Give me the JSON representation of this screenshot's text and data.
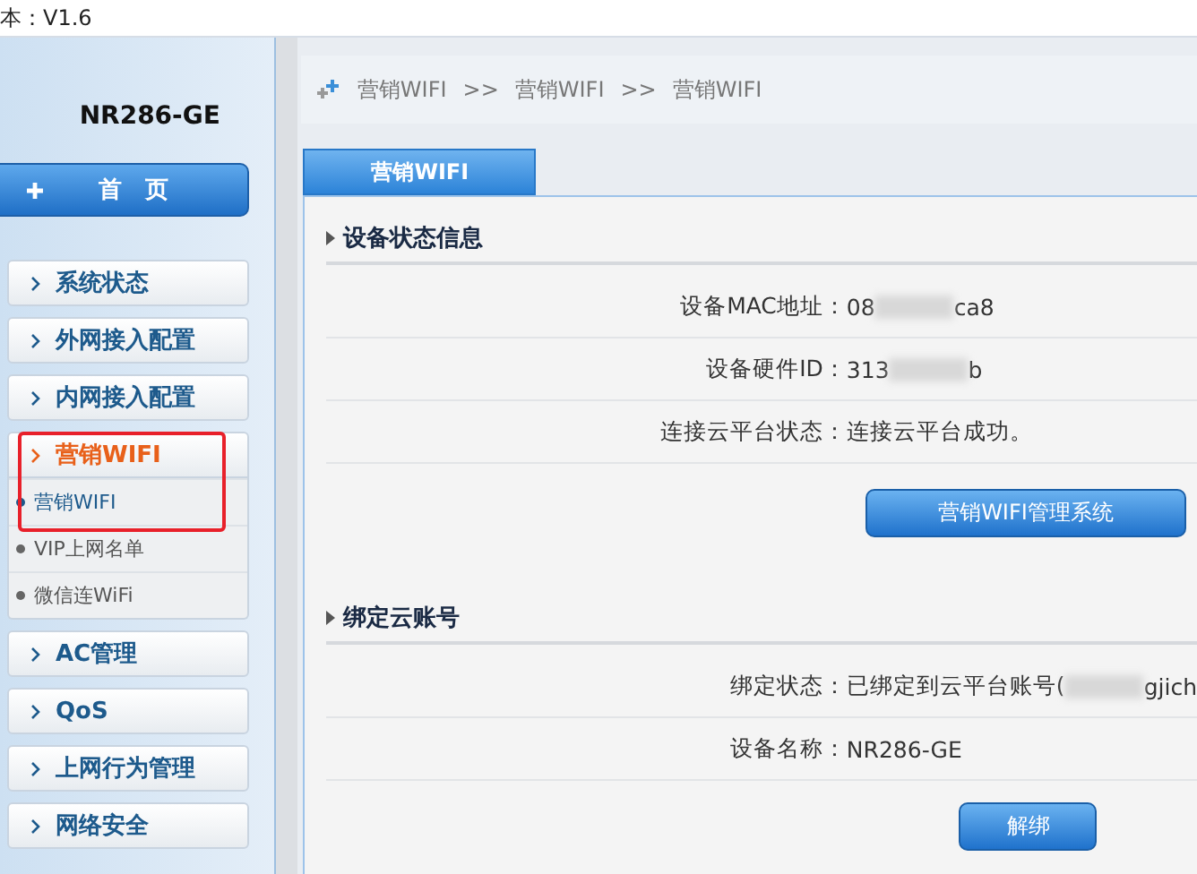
{
  "top_bar": {
    "version": "本：V1.6"
  },
  "sidebar": {
    "device_name": "NR286-GE",
    "home_button": "首　页",
    "menu": [
      {
        "label": "系统状态",
        "expanded": false,
        "highlighted": false
      },
      {
        "label": "外网接入配置",
        "expanded": false,
        "highlighted": false
      },
      {
        "label": "内网接入配置",
        "expanded": false,
        "highlighted": false
      },
      {
        "label": "营销WIFI",
        "expanded": true,
        "highlighted": true,
        "children": [
          {
            "label": "营销WIFI",
            "selected": true
          },
          {
            "label": "VIP上网名单",
            "selected": false
          },
          {
            "label": "微信连WiFi",
            "selected": false
          }
        ]
      },
      {
        "label": "AC管理",
        "expanded": false,
        "highlighted": false
      },
      {
        "label": "QoS",
        "expanded": false,
        "highlighted": false
      },
      {
        "label": "上网行为管理",
        "expanded": false,
        "highlighted": false
      },
      {
        "label": "网络安全",
        "expanded": false,
        "highlighted": false
      }
    ]
  },
  "breadcrumb": [
    "营销WIFI",
    ">>",
    "营销WIFI",
    ">>",
    "营销WIFI"
  ],
  "tab": {
    "label": "营销WIFI"
  },
  "sections": [
    {
      "title": "设备状态信息",
      "rows": [
        {
          "label": "设备MAC地址：",
          "value_start": "08",
          "value_end": "ca8",
          "redacted": true
        },
        {
          "label": "设备硬件ID：",
          "value_start": "313",
          "value_end": "b",
          "redacted": true
        },
        {
          "label": "连接云平台状态：",
          "value_start": "连接云平台成功。",
          "redacted": false
        }
      ],
      "button": "营销WIFI管理系统",
      "kind": "wide"
    },
    {
      "title": "绑定云账号",
      "rows": [
        {
          "label": "绑定状态：",
          "value_start": "已绑定到云平台账号(",
          "value_end": "gjich",
          "redacted": true
        },
        {
          "label": "设备名称：",
          "value_start": "NR286-GE",
          "redacted": false
        }
      ],
      "button": "解绑",
      "kind": "small"
    }
  ]
}
